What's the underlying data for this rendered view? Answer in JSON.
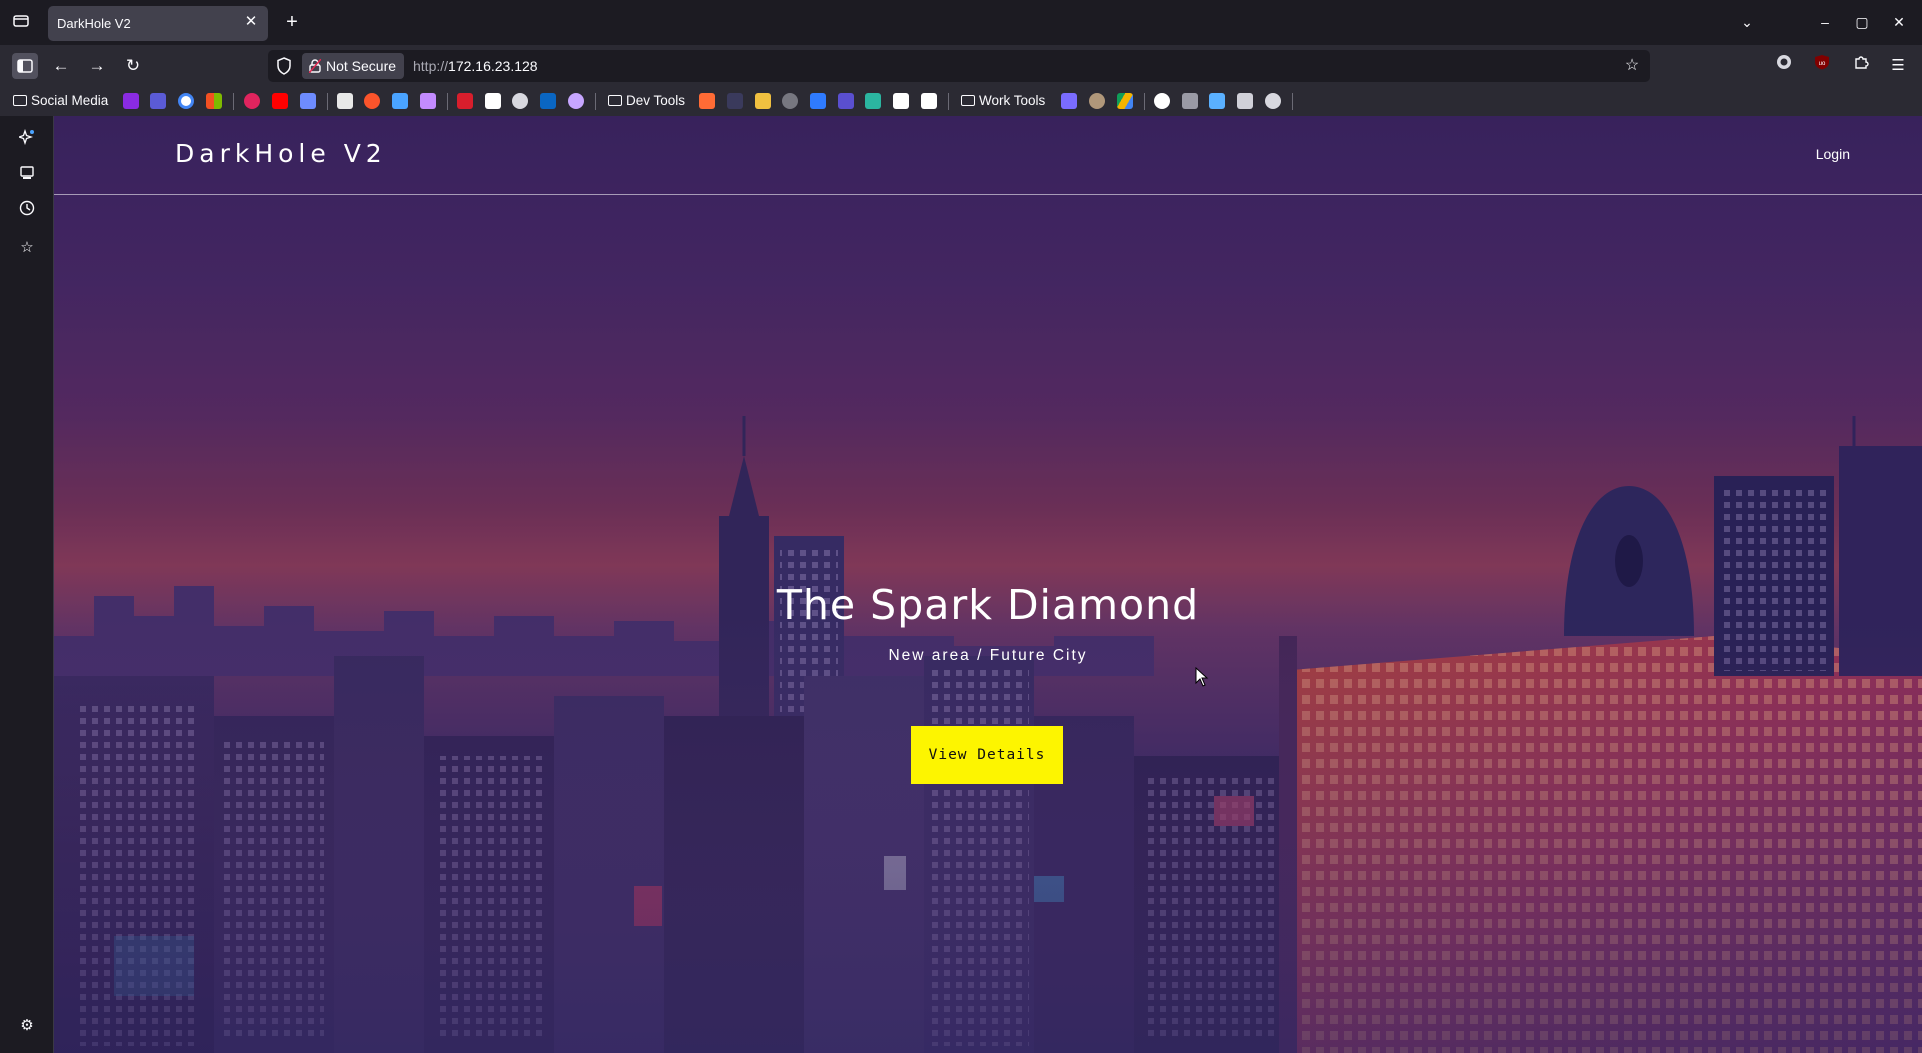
{
  "browser": {
    "tab": {
      "title": "DarkHole V2",
      "close": "✕"
    },
    "new_tab": "+",
    "window_controls": {
      "list": "⌄",
      "minimize": "–",
      "maximize": "▢",
      "close": "✕"
    },
    "nav": {
      "back": "←",
      "forward": "→",
      "reload": "↻"
    },
    "urlbar": {
      "security_label": "Not Secure",
      "url_protocol": "http://",
      "url_host": "172.16.23.128"
    },
    "bookmarks": {
      "folders": [
        "Social Media",
        "Dev Tools",
        "Work Tools"
      ]
    },
    "colors": {
      "chrome_dark": "#1c1b22",
      "chrome": "#2b2a33",
      "tab_active": "#42414d"
    }
  },
  "sidebar": {
    "icons": [
      "sparkle-icon",
      "sync-tabs-icon",
      "history-icon",
      "bookmark-star-icon",
      "settings-icon"
    ]
  },
  "site": {
    "brand": "DarkHole V2",
    "login": "Login",
    "hero": {
      "title": "The Spark Diamond",
      "subtitle": "New area / Future City",
      "button": "View Details"
    },
    "colors": {
      "button_bg": "#fdf500",
      "text": "#ffffff"
    }
  }
}
